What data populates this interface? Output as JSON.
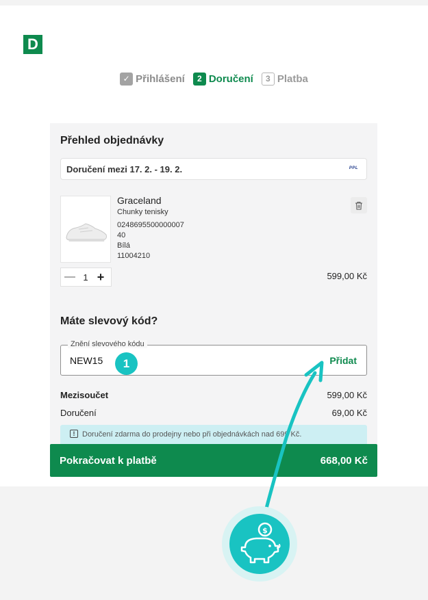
{
  "brand": {
    "logo_letter": "D",
    "accent": "#0e8a4e",
    "annotation_color": "#19c3c2"
  },
  "steps": [
    {
      "number": "✓",
      "label": "Přihlášení",
      "state": "done"
    },
    {
      "number": "2",
      "label": "Doručení",
      "state": "active"
    },
    {
      "number": "3",
      "label": "Platba",
      "state": "todo"
    }
  ],
  "order": {
    "title": "Přehled objednávky",
    "delivery_text": "Doručení mezi 17. 2. - 19. 2.",
    "carrier_logo_text": "PPL",
    "item": {
      "name": "Graceland",
      "type": "Chunky tenisky",
      "ean": "0248695500000007",
      "size": "40",
      "color": "Bílá",
      "code": "11004210",
      "quantity": "1",
      "price": "599,00 Kč"
    }
  },
  "promo": {
    "title": "Máte slevový kód?",
    "legend": "Znění slevového kódu",
    "value": "NEW15",
    "add_label": "Přidat",
    "annotation_number": "1"
  },
  "summary": {
    "subtotal_label": "Mezisoučet",
    "subtotal_value": "599,00 Kč",
    "delivery_label": "Doručení",
    "delivery_value": "69,00 Kč",
    "notice": "Doručení zdarma do prodejny nebo při objednávkách nad 699 Kč."
  },
  "cta": {
    "label": "Pokračovat k platbě",
    "total": "668,00 Kč"
  }
}
